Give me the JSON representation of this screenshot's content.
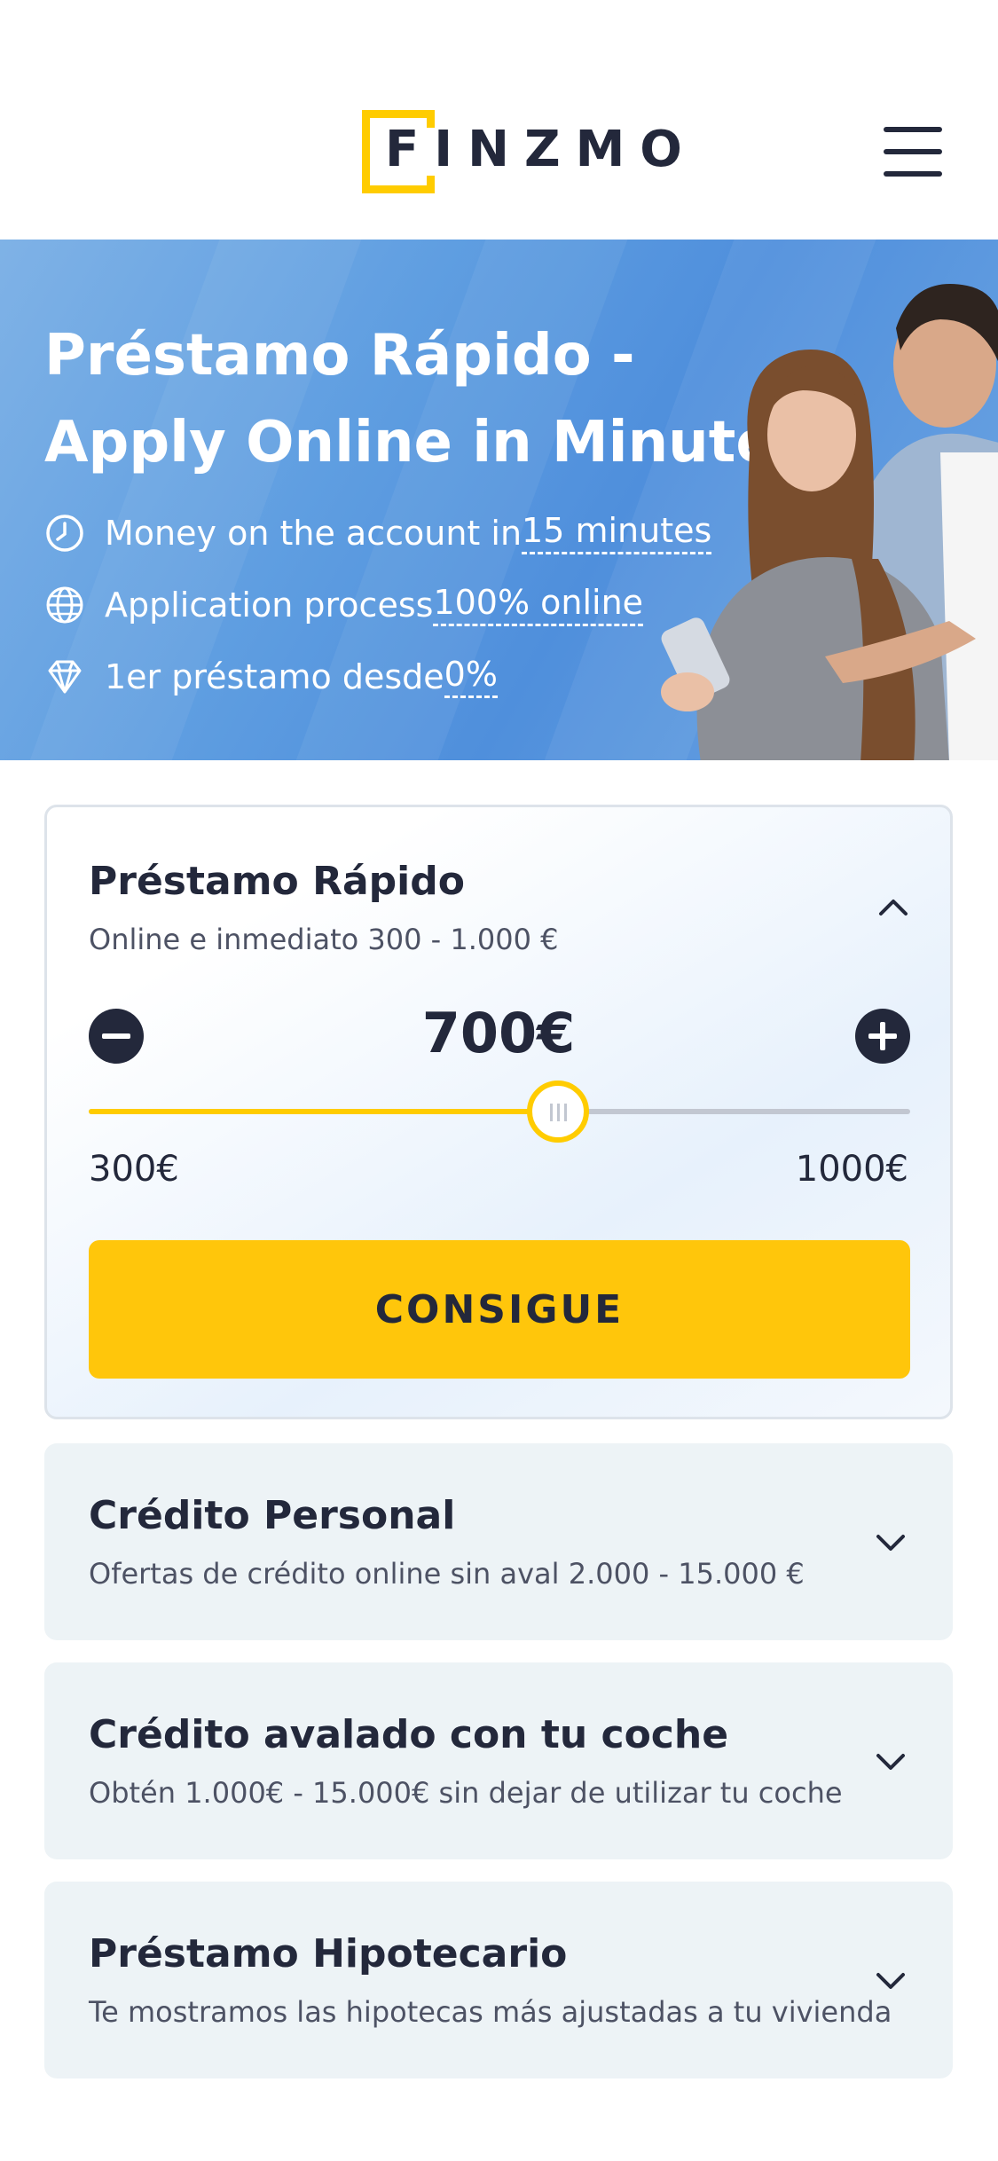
{
  "header": {
    "logo_text": "FINZMO",
    "brand_color": "#ffcc00",
    "menu_icon": "hamburger-menu-icon"
  },
  "hero": {
    "title": "Préstamo Rápido - Apply Online in Minutes",
    "features": [
      {
        "icon": "clock-icon",
        "text": "Money on the account in ",
        "highlight": "15 minutes"
      },
      {
        "icon": "globe-icon",
        "text": "Application process ",
        "highlight": "100% online"
      },
      {
        "icon": "diamond-icon",
        "text": "1er préstamo desde ",
        "highlight": "0%"
      }
    ]
  },
  "loan_calculator": {
    "title": "Préstamo Rápido",
    "subtitle": "Online e inmediato 300 - 1.000 €",
    "amount": "700€",
    "slider_value": 700,
    "slider_min": 300,
    "slider_max": 1000,
    "min_label": "300€",
    "max_label": "1000€",
    "cta_label": "CONSIGUE",
    "cta_color": "#ffc60b",
    "expanded": true
  },
  "products": [
    {
      "title": "Crédito Personal",
      "subtitle": "Ofertas de crédito online sin aval 2.000 - 15.000 €"
    },
    {
      "title": "Crédito avalado con tu coche",
      "subtitle": "Obtén 1.000€ - 15.000€ sin dejar de utilizar tu coche"
    },
    {
      "title": "Préstamo Hipotecario",
      "subtitle": "Te mostramos las hipotecas más ajustadas a tu vivienda"
    }
  ]
}
